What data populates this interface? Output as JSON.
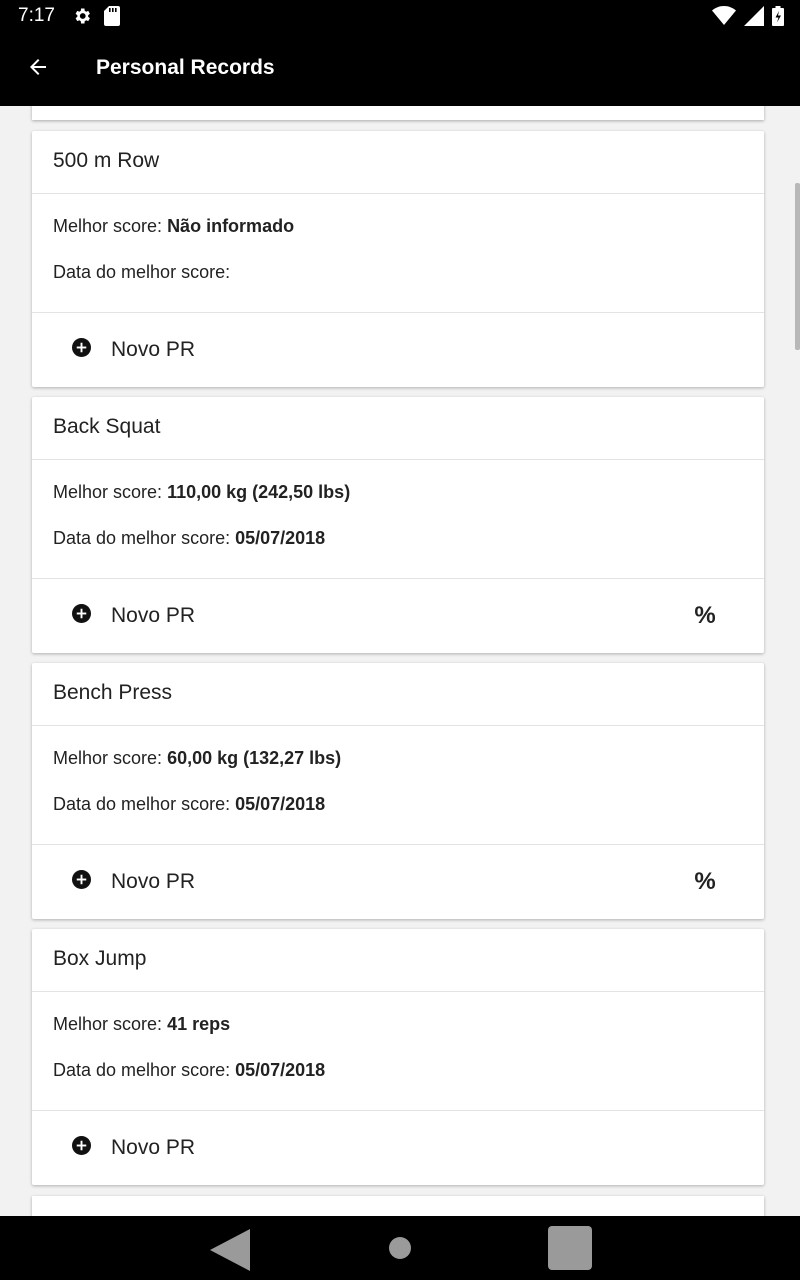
{
  "status_bar": {
    "time": "7:17"
  },
  "app_bar": {
    "title": "Personal Records"
  },
  "records": [
    {
      "name": "500 m Row",
      "best_label": "Melhor score:",
      "best_value": "Não informado",
      "date_label": "Data do melhor score:",
      "date_value": "",
      "action_label": "Novo PR",
      "percent_label": ""
    },
    {
      "name": "Back Squat",
      "best_label": "Melhor score:",
      "best_value": "110,00 kg (242,50 lbs)",
      "date_label": "Data do melhor score:",
      "date_value": "05/07/2018",
      "action_label": "Novo PR",
      "percent_label": "%"
    },
    {
      "name": "Bench Press",
      "best_label": "Melhor score:",
      "best_value": "60,00 kg (132,27 lbs)",
      "date_label": "Data do melhor score:",
      "date_value": "05/07/2018",
      "action_label": "Novo PR",
      "percent_label": "%"
    },
    {
      "name": "Box Jump",
      "best_label": "Melhor score:",
      "best_value": "41 reps",
      "date_label": "Data do melhor score:",
      "date_value": "05/07/2018",
      "action_label": "Novo PR",
      "percent_label": ""
    }
  ]
}
